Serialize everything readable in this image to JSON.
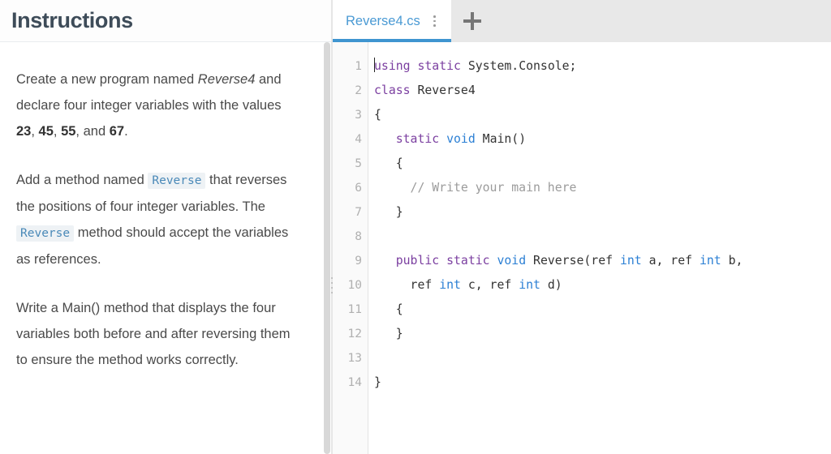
{
  "theme": {
    "accent_blue": "#3f95d0",
    "tab_text_blue": "#4a9ad4",
    "header_text": "#3e4c59",
    "body_text": "#4a4a4a",
    "inline_code_text": "#4a89b8",
    "inline_code_bg": "#eef2f5",
    "tabbar_bg": "#e8e8e8",
    "gutter_bg": "#fafafa",
    "keyword_purple": "#7b3fa0",
    "keyword_blue": "#2b7fd4",
    "comment_gray": "#9b9b9b"
  },
  "instructions": {
    "title": "Instructions",
    "paragraphs": [
      {
        "id": "p1",
        "parts": [
          {
            "type": "text",
            "text": "Create a new program named "
          },
          {
            "type": "italic",
            "text": "Reverse4"
          },
          {
            "type": "text",
            "text": " and declare four integer variables with the values "
          },
          {
            "type": "bold",
            "text": "23"
          },
          {
            "type": "text",
            "text": ", "
          },
          {
            "type": "bold",
            "text": "45"
          },
          {
            "type": "text",
            "text": ", "
          },
          {
            "type": "bold",
            "text": "55"
          },
          {
            "type": "text",
            "text": ", and "
          },
          {
            "type": "bold",
            "text": "67"
          },
          {
            "type": "text",
            "text": "."
          }
        ]
      },
      {
        "id": "p2",
        "parts": [
          {
            "type": "text",
            "text": "Add a method named "
          },
          {
            "type": "code",
            "text": "Reverse"
          },
          {
            "type": "text",
            "text": " that reverses the positions of four integer variables. The "
          },
          {
            "type": "code",
            "text": "Reverse"
          },
          {
            "type": "text",
            "text": " method should accept the variables as references."
          }
        ]
      },
      {
        "id": "p3",
        "parts": [
          {
            "type": "text",
            "text": "Write a Main() method that displays the four variables both before and after reversing them to ensure the method works correctly."
          }
        ]
      }
    ]
  },
  "editor": {
    "tabs": [
      {
        "label": "Reverse4.cs",
        "active": true,
        "menu_icon": "kebab-menu-icon"
      }
    ],
    "new_tab_icon": "plus-icon",
    "line_numbers": [
      "1",
      "2",
      "3",
      "4",
      "5",
      "6",
      "7",
      "8",
      "9",
      "10",
      "11",
      "12",
      "13",
      "14"
    ],
    "cursor": {
      "line": 1,
      "column": 1
    },
    "lines": [
      {
        "n": 1,
        "tokens": [
          {
            "t": "kw-purple",
            "v": "using"
          },
          {
            "t": "plain",
            "v": " "
          },
          {
            "t": "kw-purple",
            "v": "static"
          },
          {
            "t": "plain",
            "v": " System.Console;"
          }
        ]
      },
      {
        "n": 2,
        "tokens": [
          {
            "t": "kw-purple",
            "v": "class"
          },
          {
            "t": "plain",
            "v": " Reverse4"
          }
        ]
      },
      {
        "n": 3,
        "tokens": [
          {
            "t": "plain",
            "v": "{"
          }
        ]
      },
      {
        "n": 4,
        "tokens": [
          {
            "t": "plain",
            "v": "   "
          },
          {
            "t": "kw-purple",
            "v": "static"
          },
          {
            "t": "plain",
            "v": " "
          },
          {
            "t": "kw-blue",
            "v": "void"
          },
          {
            "t": "plain",
            "v": " Main()"
          }
        ]
      },
      {
        "n": 5,
        "tokens": [
          {
            "t": "plain",
            "v": "   {"
          }
        ]
      },
      {
        "n": 6,
        "tokens": [
          {
            "t": "plain",
            "v": "     "
          },
          {
            "t": "comment",
            "v": "// Write your main here"
          }
        ]
      },
      {
        "n": 7,
        "tokens": [
          {
            "t": "plain",
            "v": "   }"
          }
        ]
      },
      {
        "n": 8,
        "tokens": []
      },
      {
        "n": 9,
        "tokens": [
          {
            "t": "plain",
            "v": "   "
          },
          {
            "t": "kw-purple",
            "v": "public"
          },
          {
            "t": "plain",
            "v": " "
          },
          {
            "t": "kw-purple",
            "v": "static"
          },
          {
            "t": "plain",
            "v": " "
          },
          {
            "t": "kw-blue",
            "v": "void"
          },
          {
            "t": "plain",
            "v": " Reverse(ref "
          },
          {
            "t": "kw-blue",
            "v": "int"
          },
          {
            "t": "plain",
            "v": " a, ref "
          },
          {
            "t": "kw-blue",
            "v": "int"
          },
          {
            "t": "plain",
            "v": " b,"
          }
        ]
      },
      {
        "n": 10,
        "tokens": [
          {
            "t": "plain",
            "v": "     ref "
          },
          {
            "t": "kw-blue",
            "v": "int"
          },
          {
            "t": "plain",
            "v": " c, ref "
          },
          {
            "t": "kw-blue",
            "v": "int"
          },
          {
            "t": "plain",
            "v": " d)"
          }
        ]
      },
      {
        "n": 11,
        "tokens": [
          {
            "t": "plain",
            "v": "   {"
          }
        ]
      },
      {
        "n": 12,
        "tokens": [
          {
            "t": "plain",
            "v": "   }"
          }
        ]
      },
      {
        "n": 13,
        "tokens": []
      },
      {
        "n": 14,
        "tokens": [
          {
            "t": "plain",
            "v": "}"
          }
        ]
      }
    ]
  }
}
